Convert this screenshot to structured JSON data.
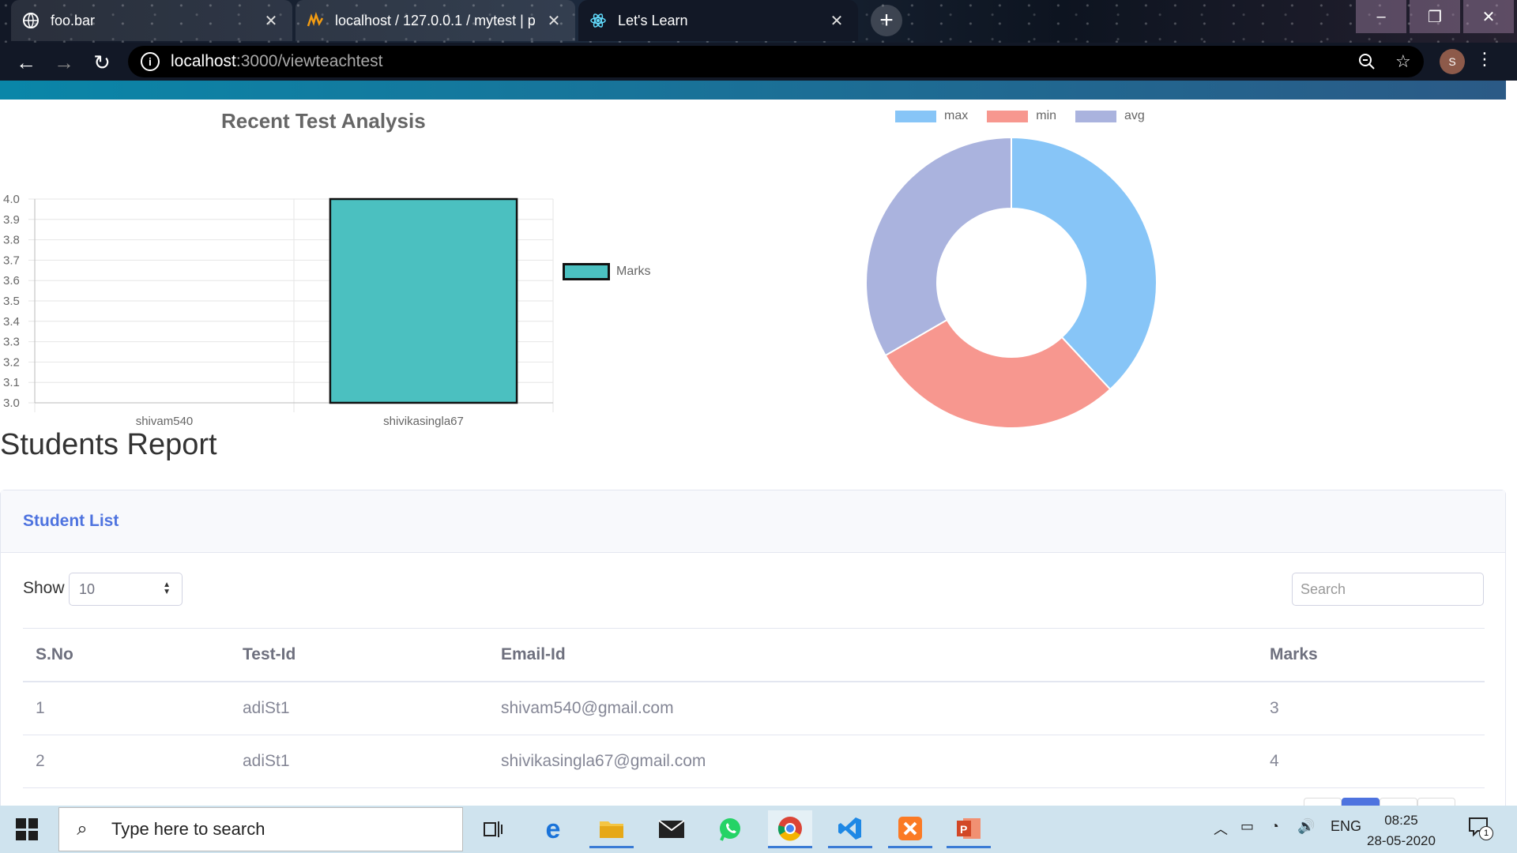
{
  "browser": {
    "tabs": [
      {
        "title": "foo.bar",
        "active": false
      },
      {
        "title": "localhost / 127.0.0.1 / mytest | p",
        "active": false
      },
      {
        "title": "Let's Learn",
        "active": true
      }
    ],
    "url_host": "localhost",
    "url_path": ":3000/viewteachtest",
    "avatar_letter": "S"
  },
  "bar_chart": {
    "title": "Recent Test Analysis",
    "legend_label": "Marks"
  },
  "chart_data": [
    {
      "type": "bar",
      "title": "Recent Test Analysis",
      "categories": [
        "shivam540",
        "shivikasingla67"
      ],
      "series": [
        {
          "name": "Marks",
          "values": [
            3,
            4
          ]
        }
      ],
      "ylim": [
        3.0,
        4.0
      ],
      "yticks": [
        "4.0",
        "3.9",
        "3.8",
        "3.7",
        "3.6",
        "3.5",
        "3.4",
        "3.3",
        "3.2",
        "3.1",
        "3.0"
      ],
      "grid": true,
      "legend": "right",
      "colors": {
        "fill": "#4bc0c0",
        "border": "#111111"
      }
    },
    {
      "type": "pie",
      "donut": true,
      "labels": [
        "max",
        "min",
        "avg"
      ],
      "values": [
        4,
        3,
        3.5
      ],
      "colors": [
        "#87c5f7",
        "#f7978f",
        "#aab3de"
      ],
      "legend": "top"
    }
  ],
  "report": {
    "title": "Students Report",
    "card_title": "Student List",
    "show_label": "Show",
    "page_size": "10",
    "search_placeholder": "Search",
    "columns": [
      "S.No",
      "Test-Id",
      "Email-Id",
      "Marks"
    ],
    "rows": [
      [
        "1",
        "adiSt1",
        "shivam540@gmail.com",
        "3"
      ],
      [
        "2",
        "adiSt1",
        "shivikasingla67@gmail.com",
        "4"
      ]
    ]
  },
  "taskbar": {
    "search_placeholder": "Type here to search",
    "language": "ENG",
    "time": "08:25",
    "date": "28-05-2020",
    "notification_count": "1"
  },
  "colors": {
    "accent": "#4e73df",
    "stripe": "#0a86a8"
  }
}
